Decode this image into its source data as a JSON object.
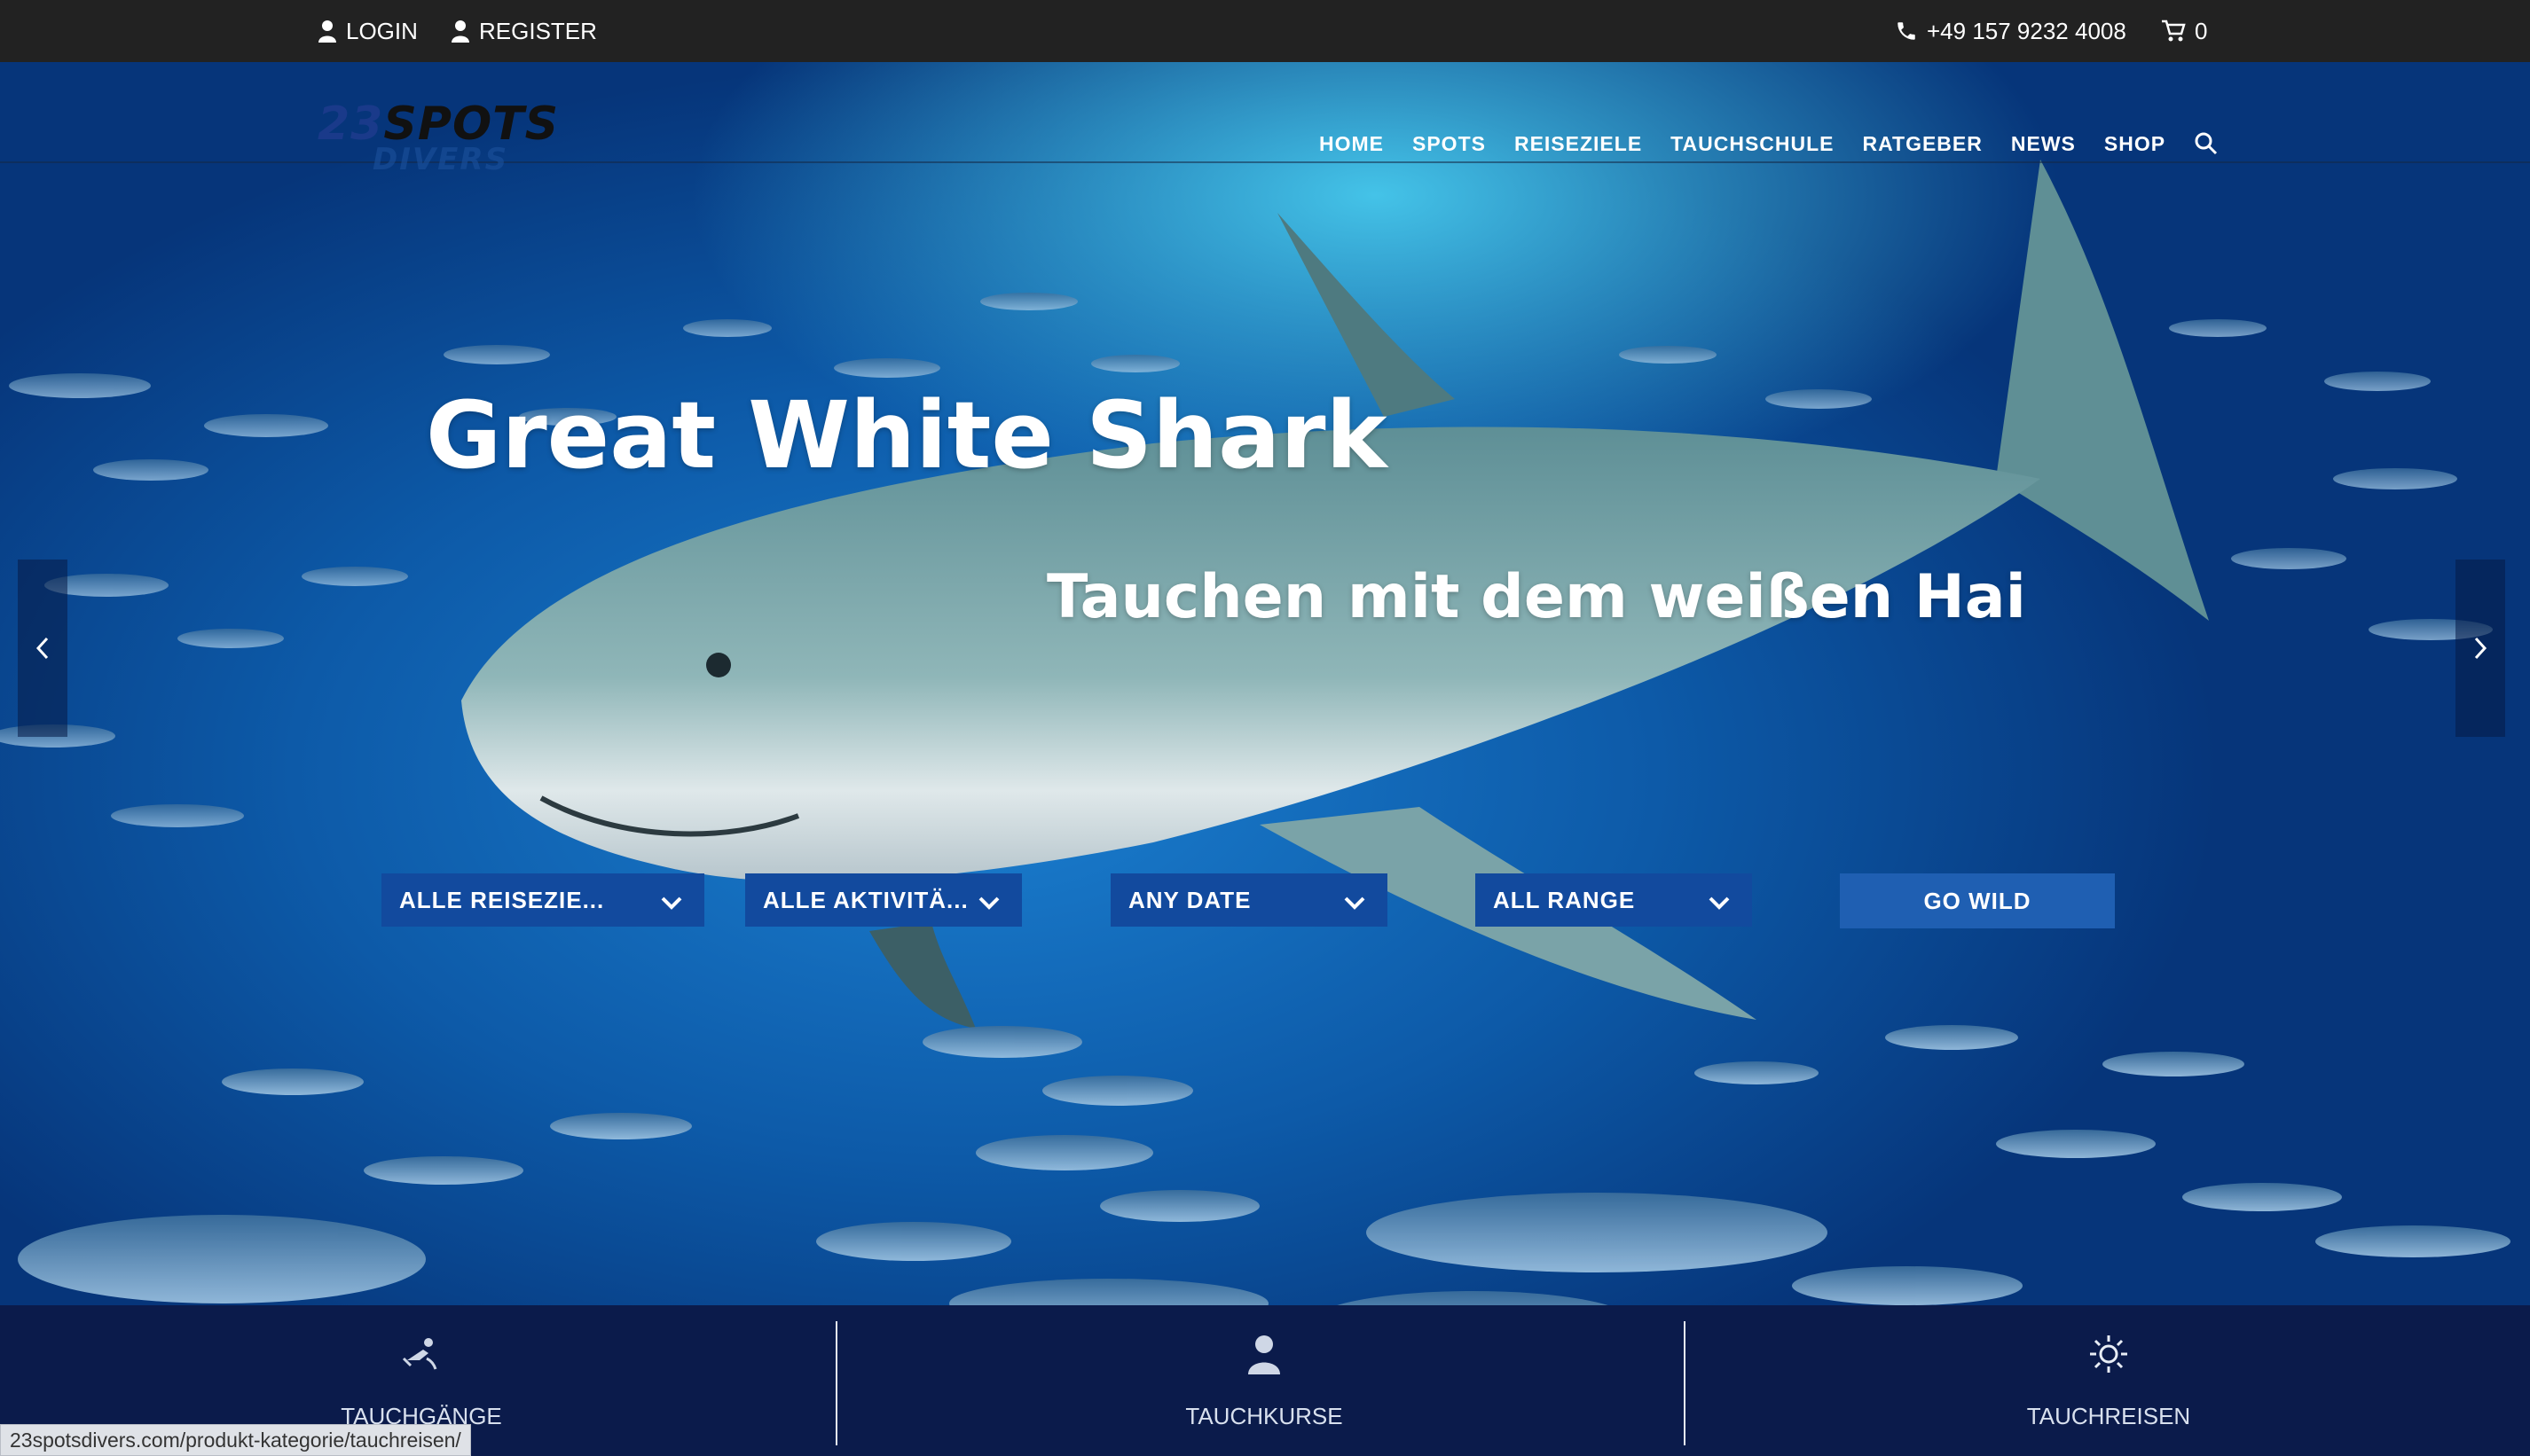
{
  "topbar": {
    "login": "LOGIN",
    "register": "REGISTER",
    "phone": "+49 157 9232 4008",
    "cart_count": "0"
  },
  "logo": {
    "line1_num": "23",
    "line1_word": "SPOTS",
    "line2": "DIVERS"
  },
  "nav": {
    "items": [
      "HOME",
      "SPOTS",
      "REISEZIELE",
      "TAUCHSCHULE",
      "RATGEBER",
      "NEWS",
      "SHOP"
    ]
  },
  "hero": {
    "title": "Great White Shark",
    "subtitle": "Tauchen mit dem weißen Hai"
  },
  "filters": {
    "destination": "ALLE REISEZIE...",
    "activity": "ALLE AKTIVITÄ...",
    "date": "ANY DATE",
    "range": "ALL RANGE",
    "submit": "GO WILD"
  },
  "bottom": {
    "items": [
      "TAUCHGÄNGE",
      "TAUCHKURSE",
      "TAUCHREISEN"
    ]
  },
  "status_url": "23spotsdivers.com/produkt-kategorie/tauchreisen/",
  "icons": {
    "login": "user-icon",
    "register": "user-icon",
    "phone": "phone-icon",
    "cart": "cart-icon",
    "search": "search-icon",
    "prev": "chevron-left-icon",
    "next": "chevron-right-icon",
    "dive": "diver-icon",
    "course": "person-icon",
    "travel": "sun-icon"
  }
}
